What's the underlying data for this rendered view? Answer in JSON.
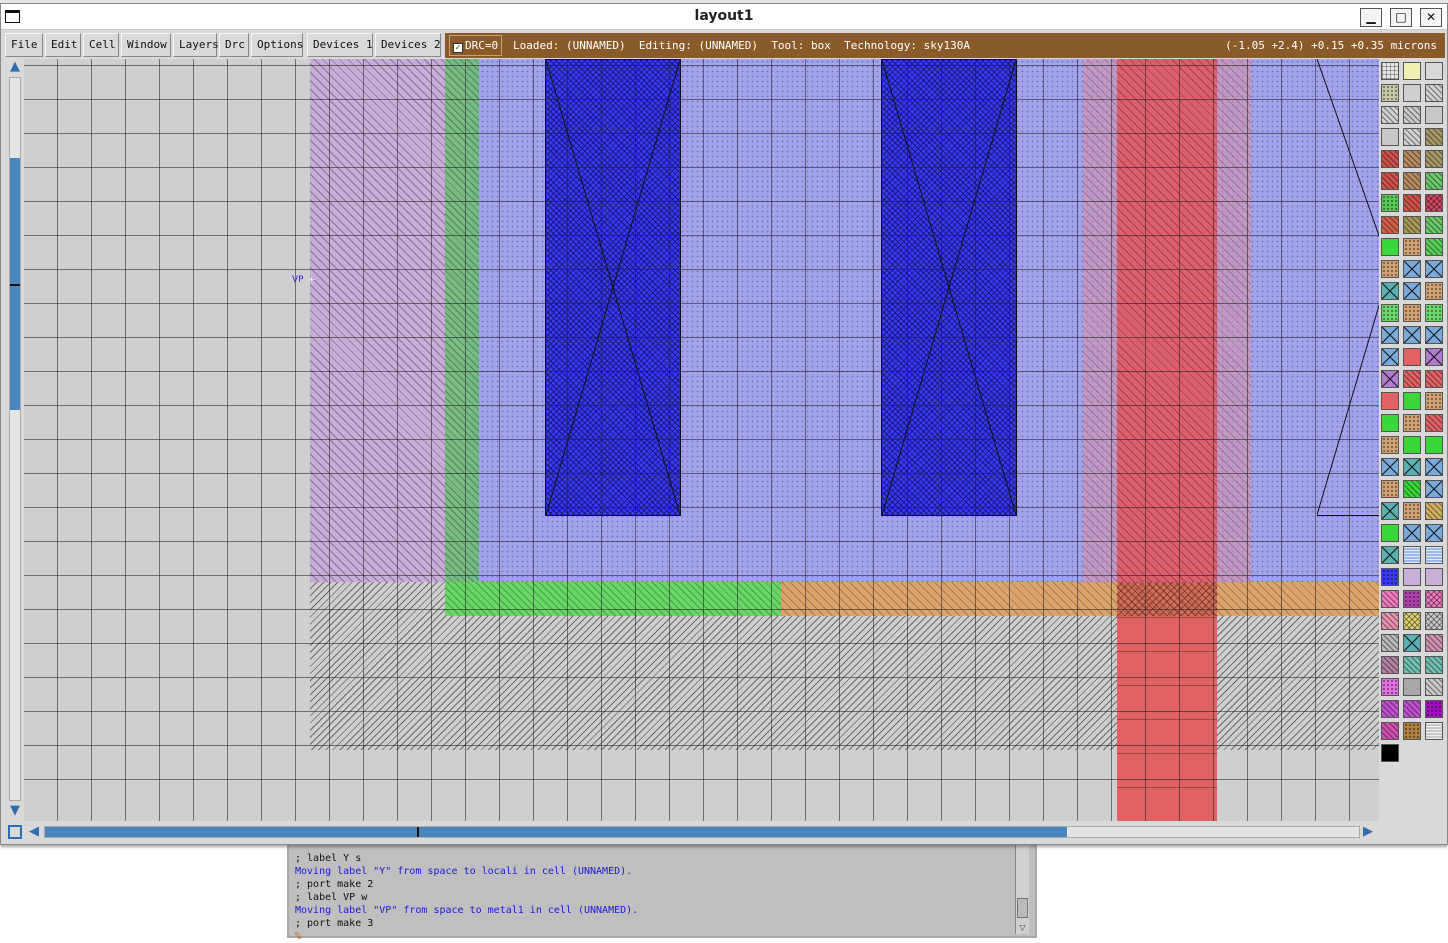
{
  "window": {
    "title": "layout1",
    "minimize_label": "▁",
    "maximize_label": "□",
    "close_label": "✕"
  },
  "menu": {
    "file": "File",
    "edit": "Edit",
    "cell": "Cell",
    "window": "Window",
    "layers": "Layers",
    "drc": "Drc",
    "options": "Options",
    "devices1": "Devices 1",
    "devices2": "Devices 2"
  },
  "status": {
    "drc_label": "DRC=0",
    "drc_checked": true,
    "loaded": "Loaded: (UNNAMED)",
    "editing": "Editing: (UNNAMED)",
    "tool": "Tool: box",
    "technology": "Technology: sky130A",
    "coords": "(-1.05 +2.4) +0.15 +0.35 microns"
  },
  "layout": {
    "label_text": "VP",
    "colors": {
      "nwell": "#c4aad6",
      "diffusion": "#a0a0ec",
      "contact": "#3a3af2",
      "poly_green": "#6ad66a",
      "tan": "#d9a46e",
      "red": "#e06264"
    }
  },
  "console": {
    "lines": [
      {
        "text": "; label Y s",
        "style": "black"
      },
      {
        "text": "Moving label \"Y\" from space to locali in cell (UNNAMED).",
        "style": "blue"
      },
      {
        "text": "; port make 2",
        "style": "black"
      },
      {
        "text": "; label VP w",
        "style": "black"
      },
      {
        "text": "Moving label \"VP\" from space to metal1 in cell (UNNAMED).",
        "style": "blue"
      },
      {
        "text": "; port make 3",
        "style": "black"
      },
      {
        "text": "%",
        "style": "prompt"
      }
    ]
  },
  "palette": {
    "swatches": [
      {
        "fill": "#e8e8e8",
        "pat": "grid"
      },
      {
        "fill": "#f0f0b0",
        "pat": "box"
      },
      {
        "fill": "#d9d9d9",
        "pat": "box"
      },
      {
        "fill": "#c8c8a8",
        "pat": "dots"
      },
      {
        "fill": "#cfcfcf",
        "pat": "none"
      },
      {
        "fill": "#d0d0d0",
        "pat": "diag"
      },
      {
        "fill": "#d0d0d0",
        "pat": "diag"
      },
      {
        "fill": "#c8c8c8",
        "pat": "diag"
      },
      {
        "fill": "#c8c8c8",
        "pat": "none"
      },
      {
        "fill": "#c8c8c8",
        "pat": "none"
      },
      {
        "fill": "#d0d0d0",
        "pat": "diag"
      },
      {
        "fill": "#a89868",
        "pat": "diag"
      },
      {
        "fill": "#d0504a",
        "pat": "diag"
      },
      {
        "fill": "#b88a60",
        "pat": "diag"
      },
      {
        "fill": "#a89868",
        "pat": "diag"
      },
      {
        "fill": "#d0504a",
        "pat": "diag"
      },
      {
        "fill": "#b88a60",
        "pat": "diag"
      },
      {
        "fill": "#6ac86a",
        "pat": "diag"
      },
      {
        "fill": "#56c856",
        "pat": "dots"
      },
      {
        "fill": "#d0504a",
        "pat": "diag"
      },
      {
        "fill": "#d04a60",
        "pat": "cross"
      },
      {
        "fill": "#d0604a",
        "pat": "diag"
      },
      {
        "fill": "#a89858",
        "pat": "diag"
      },
      {
        "fill": "#6ac86a",
        "pat": "diag"
      },
      {
        "fill": "#3ad63a",
        "pat": "none"
      },
      {
        "fill": "#d0a070",
        "pat": "dots"
      },
      {
        "fill": "#5ad05a",
        "pat": "diag"
      },
      {
        "fill": "#d0a070",
        "pat": "dots"
      },
      {
        "fill": "#7aaada",
        "pat": "x"
      },
      {
        "fill": "#7aaada",
        "pat": "x"
      },
      {
        "fill": "#5ab0b0",
        "pat": "x"
      },
      {
        "fill": "#7aaada",
        "pat": "x"
      },
      {
        "fill": "#d0a070",
        "pat": "dots"
      },
      {
        "fill": "#6ad66a",
        "pat": "dots"
      },
      {
        "fill": "#d0a070",
        "pat": "dots"
      },
      {
        "fill": "#6ad66a",
        "pat": "dots"
      },
      {
        "fill": "#7aaada",
        "pat": "x"
      },
      {
        "fill": "#7aaada",
        "pat": "x"
      },
      {
        "fill": "#7aaada",
        "pat": "x"
      },
      {
        "fill": "#7aaada",
        "pat": "x"
      },
      {
        "fill": "#e06264",
        "pat": "none"
      },
      {
        "fill": "#b07ad0",
        "pat": "x"
      },
      {
        "fill": "#b07ad0",
        "pat": "x"
      },
      {
        "fill": "#e06264",
        "pat": "diag"
      },
      {
        "fill": "#e06264",
        "pat": "diag"
      },
      {
        "fill": "#e06264",
        "pat": "none"
      },
      {
        "fill": "#3ad63a",
        "pat": "none"
      },
      {
        "fill": "#d0a070",
        "pat": "dots"
      },
      {
        "fill": "#3ad63a",
        "pat": "none"
      },
      {
        "fill": "#d0a070",
        "pat": "dots"
      },
      {
        "fill": "#e06264",
        "pat": "diag"
      },
      {
        "fill": "#d0a070",
        "pat": "dots"
      },
      {
        "fill": "#3ad63a",
        "pat": "none"
      },
      {
        "fill": "#3ad63a",
        "pat": "none"
      },
      {
        "fill": "#7aaada",
        "pat": "x"
      },
      {
        "fill": "#5ab0b0",
        "pat": "x"
      },
      {
        "fill": "#7aaada",
        "pat": "x"
      },
      {
        "fill": "#d0a070",
        "pat": "dots"
      },
      {
        "fill": "#3ad63a",
        "pat": "diag"
      },
      {
        "fill": "#7aaada",
        "pat": "x"
      },
      {
        "fill": "#5ab0b0",
        "pat": "x"
      },
      {
        "fill": "#d0a070",
        "pat": "dots"
      },
      {
        "fill": "#d0b060",
        "pat": "diag"
      },
      {
        "fill": "#3ad63a",
        "pat": "none"
      },
      {
        "fill": "#7aaada",
        "pat": "x"
      },
      {
        "fill": "#7aaada",
        "pat": "x"
      },
      {
        "fill": "#5ab0b0",
        "pat": "x"
      },
      {
        "fill": "#9ab8e8",
        "pat": "lines"
      },
      {
        "fill": "#9ab8e8",
        "pat": "lines"
      },
      {
        "fill": "#3a3af2",
        "pat": "dots"
      },
      {
        "fill": "#c8b0d8",
        "pat": "none"
      },
      {
        "fill": "#c8b0d8",
        "pat": "none"
      },
      {
        "fill": "#f07ac0",
        "pat": "diag"
      },
      {
        "fill": "#b040b0",
        "pat": "dots"
      },
      {
        "fill": "#f07ac0",
        "pat": "cross"
      },
      {
        "fill": "#e890b0",
        "pat": "diag"
      },
      {
        "fill": "#e0d070",
        "pat": "cross"
      },
      {
        "fill": "#c8c8c8",
        "pat": "cross"
      },
      {
        "fill": "#b8b8b8",
        "pat": "diag"
      },
      {
        "fill": "#5ab0b0",
        "pat": "x"
      },
      {
        "fill": "#d090b0",
        "pat": "diag"
      },
      {
        "fill": "#b080a0",
        "pat": "diag"
      },
      {
        "fill": "#70c0b0",
        "pat": "diag"
      },
      {
        "fill": "#70c0b0",
        "pat": "diag"
      },
      {
        "fill": "#e070e0",
        "pat": "dots"
      },
      {
        "fill": "#a8a8a8",
        "pat": "none"
      },
      {
        "fill": "#c8c8c8",
        "pat": "diag"
      },
      {
        "fill": "#c050d0",
        "pat": "diag"
      },
      {
        "fill": "#c050d0",
        "pat": "diag"
      },
      {
        "fill": "#a010c0",
        "pat": "dots"
      },
      {
        "fill": "#d050b0",
        "pat": "diag"
      },
      {
        "fill": "#b08040",
        "pat": "dots"
      },
      {
        "fill": "#c8c8c8",
        "pat": "lines"
      },
      {
        "fill": "#000000",
        "pat": "none"
      }
    ]
  }
}
